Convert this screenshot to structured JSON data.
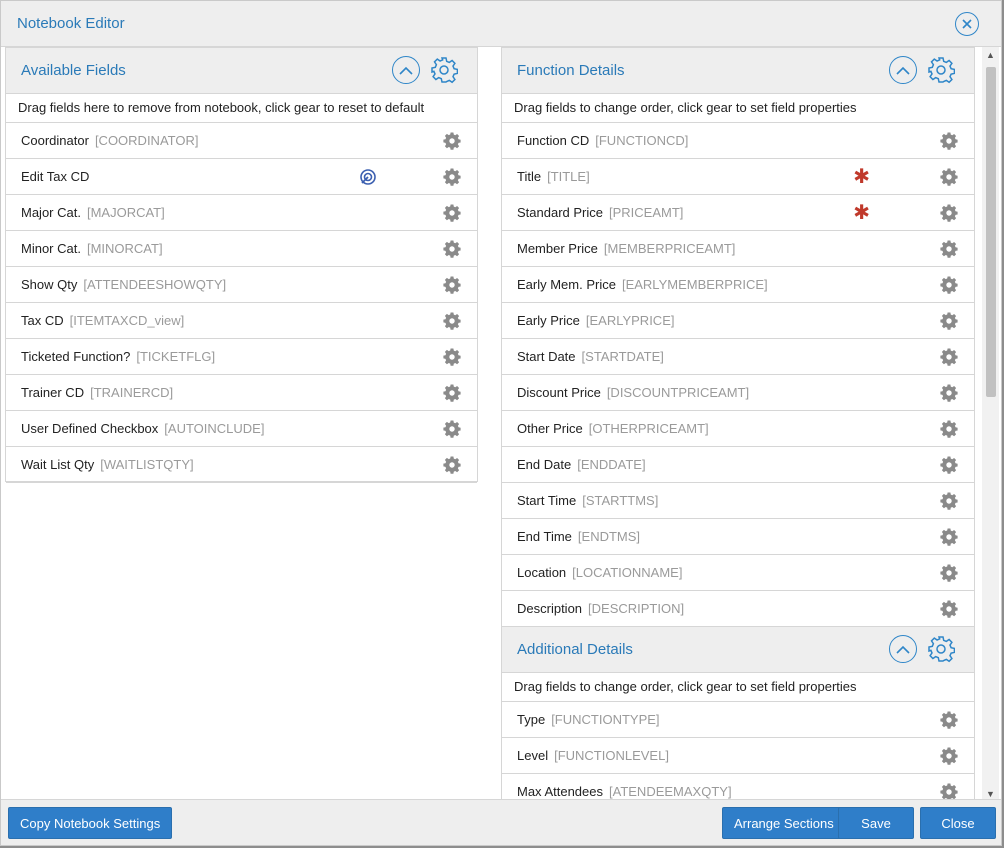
{
  "dialog": {
    "title": "Notebook Editor"
  },
  "available": {
    "title": "Available Fields",
    "hint": "Drag fields here to remove from notebook, click gear to reset to default",
    "rows": [
      {
        "label": "Coordinator",
        "field": "[COORDINATOR]"
      },
      {
        "label": "Edit Tax CD",
        "field": ""
      },
      {
        "label": "Major Cat.",
        "field": "[MAJORCAT]"
      },
      {
        "label": "Minor Cat.",
        "field": "[MINORCAT]"
      },
      {
        "label": "Show Qty",
        "field": "[ATTENDEESHOWQTY]"
      },
      {
        "label": "Tax CD",
        "field": "[ITEMTAXCD_view]"
      },
      {
        "label": "Ticketed Function?",
        "field": "[TICKETFLG]"
      },
      {
        "label": "Trainer CD",
        "field": "[TRAINERCD]"
      },
      {
        "label": "User Defined Checkbox",
        "field": "[AUTOINCLUDE]"
      },
      {
        "label": "Wait List Qty",
        "field": "[WAITLISTQTY]"
      }
    ]
  },
  "function_details": {
    "title": "Function Details",
    "hint": "Drag fields to change order, click gear to set field properties",
    "rows": [
      {
        "label": "Function CD",
        "field": "[FUNCTIONCD]"
      },
      {
        "label": "Title",
        "field": "[TITLE]"
      },
      {
        "label": "Standard Price",
        "field": "[PRICEAMT]"
      },
      {
        "label": "Member Price",
        "field": "[MEMBERPRICEAMT]"
      },
      {
        "label": "Early Mem. Price",
        "field": "[EARLYMEMBERPRICE]"
      },
      {
        "label": "Early Price",
        "field": "[EARLYPRICE]"
      },
      {
        "label": "Start Date",
        "field": "[STARTDATE]"
      },
      {
        "label": "Discount Price",
        "field": "[DISCOUNTPRICEAMT]"
      },
      {
        "label": "Other Price",
        "field": "[OTHERPRICEAMT]"
      },
      {
        "label": "End Date",
        "field": "[ENDDATE]"
      },
      {
        "label": "Start Time",
        "field": "[STARTTMS]"
      },
      {
        "label": "End Time",
        "field": "[ENDTMS]"
      },
      {
        "label": "Location",
        "field": "[LOCATIONNAME]"
      },
      {
        "label": "Description",
        "field": "[DESCRIPTION]"
      }
    ]
  },
  "additional_details": {
    "title": "Additional Details",
    "hint": "Drag fields to change order, click gear to set field properties",
    "rows": [
      {
        "label": "Type",
        "field": "[FUNCTIONTYPE]"
      },
      {
        "label": "Level",
        "field": "[FUNCTIONLEVEL]"
      },
      {
        "label": "Max Attendees",
        "field": "[ATENDEEMAXQTY]"
      }
    ]
  },
  "footer": {
    "copy_label": "Copy Notebook Settings",
    "arrange_label": "Arrange Sections",
    "save_label": "Save",
    "close_label": "Close"
  },
  "colors": {
    "accent": "#2f7ec9",
    "required": "#c0392b",
    "title_text": "#2a7ab8"
  },
  "icons": {
    "gear": "gear-icon",
    "collapse": "chevron-up-icon",
    "close": "close-icon",
    "required": "asterisk-icon",
    "special": "target-icon"
  }
}
